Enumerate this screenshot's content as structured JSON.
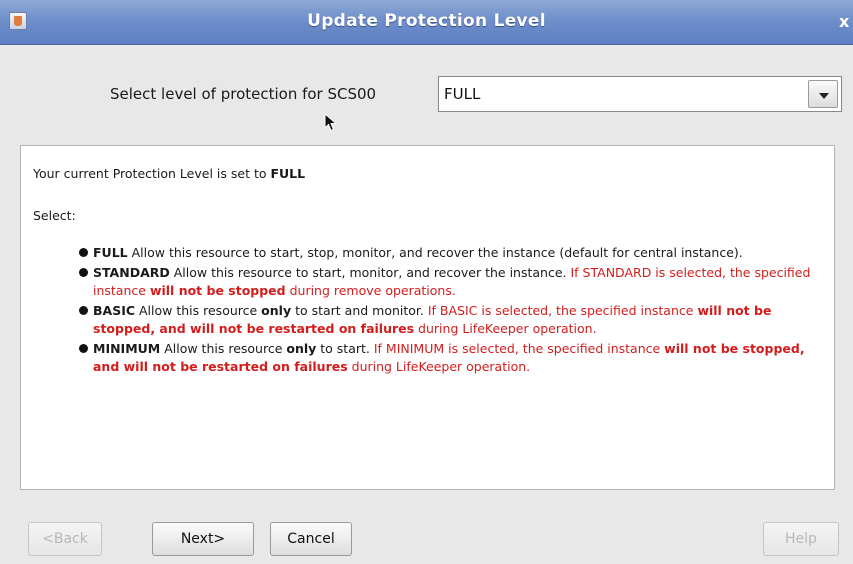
{
  "window": {
    "title": "Update Protection Level",
    "close_glyph": "x"
  },
  "selector": {
    "label": "Select level of protection for SCS00",
    "value": "FULL"
  },
  "content": {
    "current_prefix": "Your current Protection Level is set to ",
    "current_level": "FULL",
    "select_label": "Select:",
    "levels": [
      {
        "name": "FULL",
        "parts": [
          {
            "t": " Allow this resource to start, stop, monitor, and recover the instance (default for central instance).",
            "s": ""
          }
        ]
      },
      {
        "name": "STANDARD",
        "parts": [
          {
            "t": " Allow this resource to start, monitor, and recover the instance. ",
            "s": ""
          },
          {
            "t": "If STANDARD is selected, the specified instance ",
            "s": "red"
          },
          {
            "t": "will not be stopped",
            "s": "redbold"
          },
          {
            "t": " during remove operations.",
            "s": "red"
          }
        ]
      },
      {
        "name": "BASIC",
        "parts": [
          {
            "t": " Allow this resource ",
            "s": ""
          },
          {
            "t": "only",
            "s": "bold"
          },
          {
            "t": " to start and monitor. ",
            "s": ""
          },
          {
            "t": "If BASIC is selected, the specified instance ",
            "s": "red"
          },
          {
            "t": "will not be stopped, and will not be restarted on failures",
            "s": "redbold"
          },
          {
            "t": " during LifeKeeper operation.",
            "s": "red"
          }
        ]
      },
      {
        "name": "MINIMUM",
        "parts": [
          {
            "t": " Allow this resource ",
            "s": ""
          },
          {
            "t": "only",
            "s": "bold"
          },
          {
            "t": " to start. ",
            "s": ""
          },
          {
            "t": "If MINIMUM is selected, the specified instance ",
            "s": "red"
          },
          {
            "t": "will not be stopped, and will not be restarted on failures",
            "s": "redbold"
          },
          {
            "t": " during LifeKeeper operation.",
            "s": "red"
          }
        ]
      }
    ]
  },
  "buttons": {
    "back": "<Back",
    "next": "Next>",
    "cancel": "Cancel",
    "help": "Help"
  },
  "colors": {
    "title_bar": "#6f8fcb",
    "warning_text": "#d31d1d"
  },
  "icons": {
    "window": "app-icon",
    "dropdown": "chevron-down-icon",
    "cursor": "mouse-cursor-icon"
  }
}
